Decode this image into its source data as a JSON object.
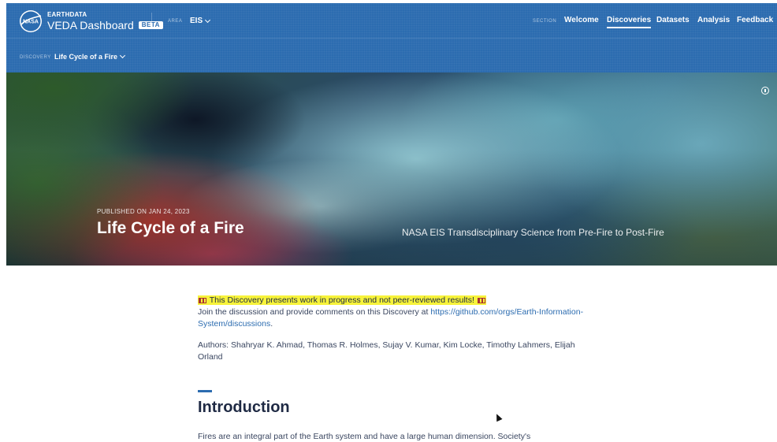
{
  "header": {
    "brand_small": "EARTHDATA",
    "brand_main": "VEDA Dashboard",
    "beta": "BETA",
    "area_label": "AREA",
    "area_value": "EIS",
    "section_label": "SECTION",
    "nav": [
      {
        "label": "Welcome",
        "active": false
      },
      {
        "label": "Discoveries",
        "active": true
      },
      {
        "label": "Datasets",
        "active": false
      },
      {
        "label": "Analysis",
        "active": false
      },
      {
        "label": "Feedback",
        "active": false
      }
    ]
  },
  "subheader": {
    "label": "DISCOVERY",
    "value": "Life Cycle of a Fire"
  },
  "hero": {
    "published": "PUBLISHED ON JAN 24, 2023",
    "title": "Life Cycle of a Fire",
    "subtitle": "NASA EIS Transdisciplinary Science from Pre-Fire to Post-Fire"
  },
  "content": {
    "warning": "This Discovery presents work in progress and not peer-reviewed results!",
    "join_text": "Join the discussion and provide comments on this Discovery at ",
    "join_link": "https://github.com/orgs/Earth-Information-System/discussions",
    "join_end": ".",
    "authors": "Authors: Shahryar K. Ahmad, Thomas R. Holmes, Sujay V. Kumar, Kim Locke, Timothy Lahmers, Elijah Orland",
    "intro_title": "Introduction",
    "intro_text": "Fires are an integral part of the Earth system and have a large human dimension. Society's"
  },
  "colors": {
    "primary": "#2c6cb0",
    "highlight": "#f7f33a"
  }
}
